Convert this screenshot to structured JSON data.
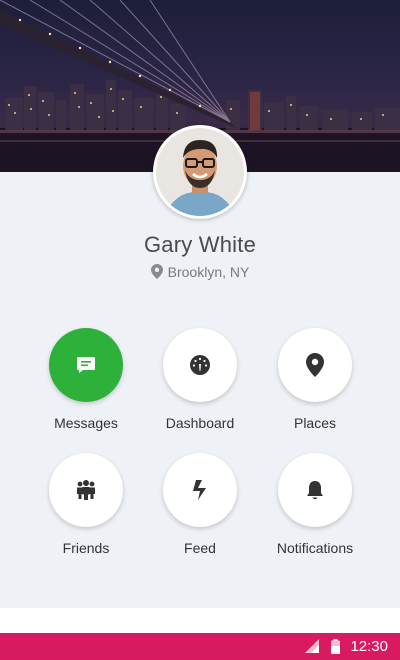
{
  "profile": {
    "name": "Gary White",
    "location": "Brooklyn, NY"
  },
  "menu": [
    {
      "label": "Messages",
      "icon": "message-icon",
      "active": true
    },
    {
      "label": "Dashboard",
      "icon": "dashboard-icon",
      "active": false
    },
    {
      "label": "Places",
      "icon": "place-icon",
      "active": false
    },
    {
      "label": "Friends",
      "icon": "friends-icon",
      "active": false
    },
    {
      "label": "Feed",
      "icon": "feed-icon",
      "active": false
    },
    {
      "label": "Notifications",
      "icon": "bell-icon",
      "active": false
    }
  ],
  "status_bar": {
    "time": "12:30"
  },
  "colors": {
    "accent": "#2db13b",
    "status_bar": "#d81b60",
    "card_bg": "#eef1f5"
  }
}
